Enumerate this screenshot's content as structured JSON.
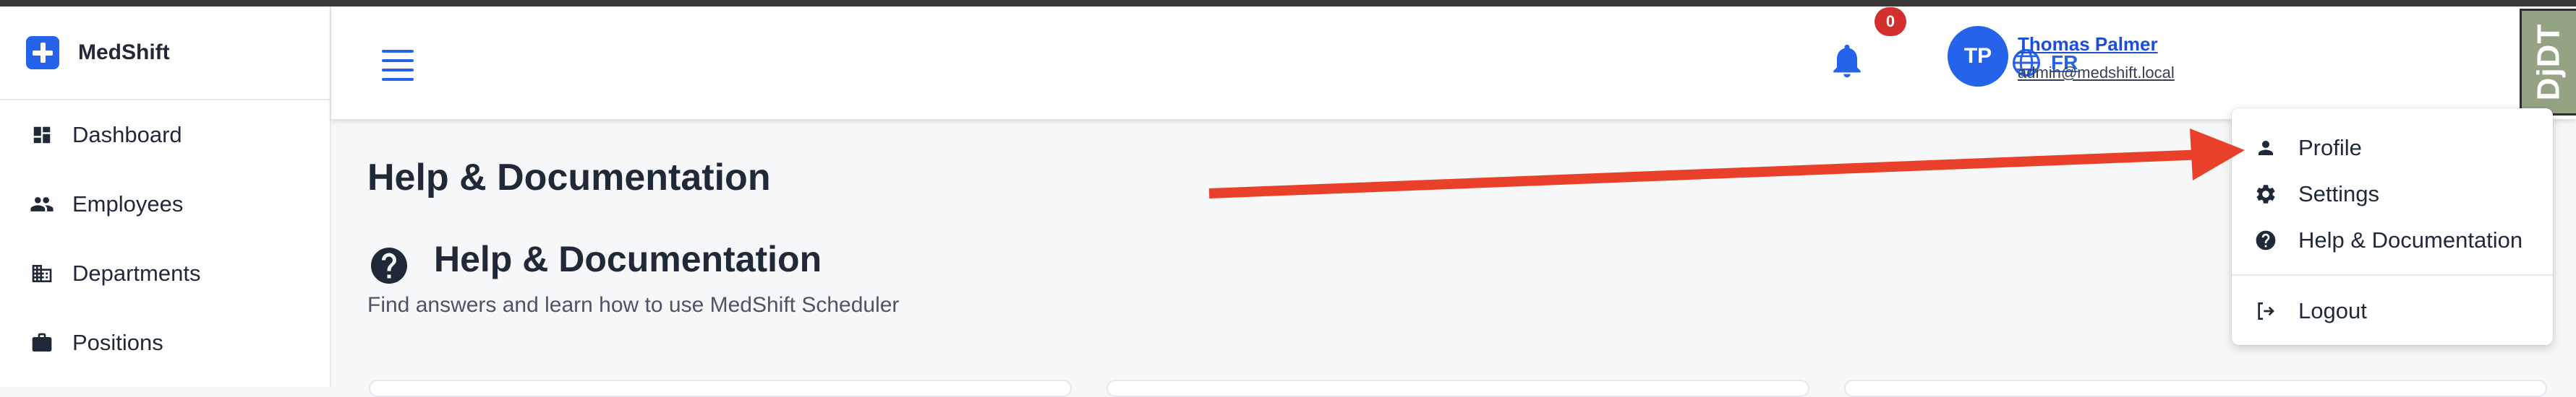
{
  "app": {
    "brand": "MedShift"
  },
  "sidebar": {
    "items": [
      {
        "label": "Dashboard",
        "icon": "dashboard-icon"
      },
      {
        "label": "Employees",
        "icon": "people-icon"
      },
      {
        "label": "Departments",
        "icon": "building-icon"
      },
      {
        "label": "Positions",
        "icon": "briefcase-icon"
      }
    ]
  },
  "header": {
    "language": "FR",
    "notifications_count": "0",
    "user": {
      "initials": "TP",
      "name": "Thomas Palmer",
      "email": "admin@medshift.local"
    },
    "debug_toolbar_label": "DjDT"
  },
  "main": {
    "page_title": "Help & Documentation",
    "section_title": "Help & Documentation",
    "section_subtitle": "Find answers and learn how to use MedShift Scheduler"
  },
  "user_menu": {
    "items": [
      {
        "label": "Profile",
        "icon": "person-icon"
      },
      {
        "label": "Settings",
        "icon": "gear-icon"
      },
      {
        "label": "Help & Documentation",
        "icon": "help-icon"
      },
      {
        "label": "Logout",
        "icon": "logout-icon"
      }
    ]
  },
  "colors": {
    "primary": "#2563eb",
    "badge": "#d32f2f",
    "annotation_arrow": "#e8402a",
    "debug_toolbar": "#94a384"
  }
}
